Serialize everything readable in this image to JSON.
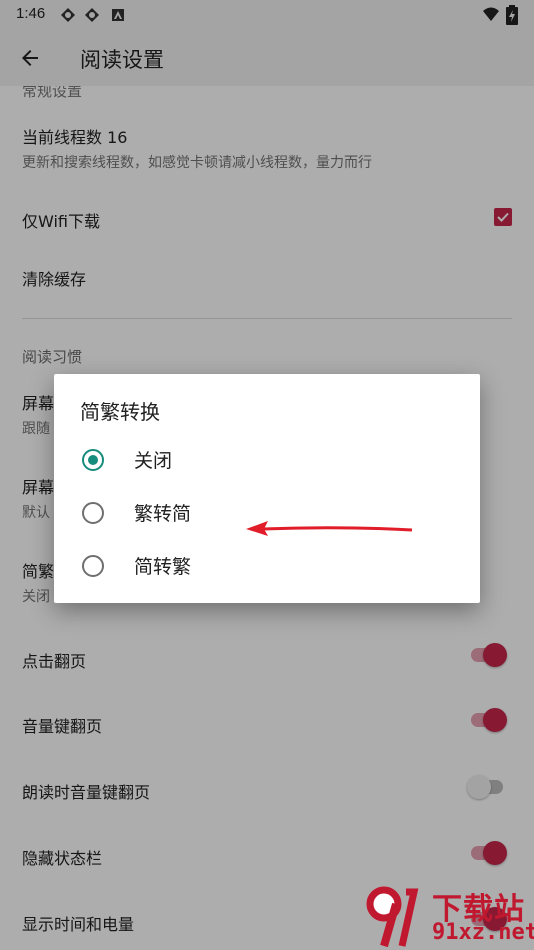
{
  "status_bar": {
    "time": "1:46"
  },
  "app_bar": {
    "title": "阅读设置"
  },
  "settings": {
    "partial_header": "常规设置",
    "thread_count": {
      "title": "当前线程数 16",
      "subtitle": "更新和搜索线程数，如感觉卡顿请减小线程数，量力而行"
    },
    "wifi_only": {
      "title": "仅Wifi下载",
      "checked": true
    },
    "clear_cache": {
      "title": "清除缓存"
    },
    "category_reading": "阅读习惯",
    "screen_a": {
      "title": "屏幕",
      "subtitle": "跟随"
    },
    "screen_b": {
      "title": "屏幕",
      "subtitle": "默认"
    },
    "conversion": {
      "title": "简繁",
      "subtitle": "关闭"
    },
    "tap_page": {
      "title": "点击翻页",
      "on": true
    },
    "volume_page": {
      "title": "音量键翻页",
      "on": true
    },
    "tts_volume_page": {
      "title": "朗读时音量键翻页",
      "on": false
    },
    "hide_status_bar": {
      "title": "隐藏状态栏",
      "on": true
    },
    "show_time_battery": {
      "title": "显示时间和电量",
      "on": true
    }
  },
  "dialog": {
    "title": "简繁转换",
    "options": [
      {
        "label": "关闭",
        "selected": true
      },
      {
        "label": "繁转简",
        "selected": false
      },
      {
        "label": "简转繁",
        "selected": false
      }
    ]
  },
  "watermark": {
    "brand_text": "下载站",
    "domain": "91xz.net"
  },
  "colors": {
    "accent": "#c8264c",
    "dialog_accent": "#168c7d",
    "annotation": "#e11d2a"
  }
}
